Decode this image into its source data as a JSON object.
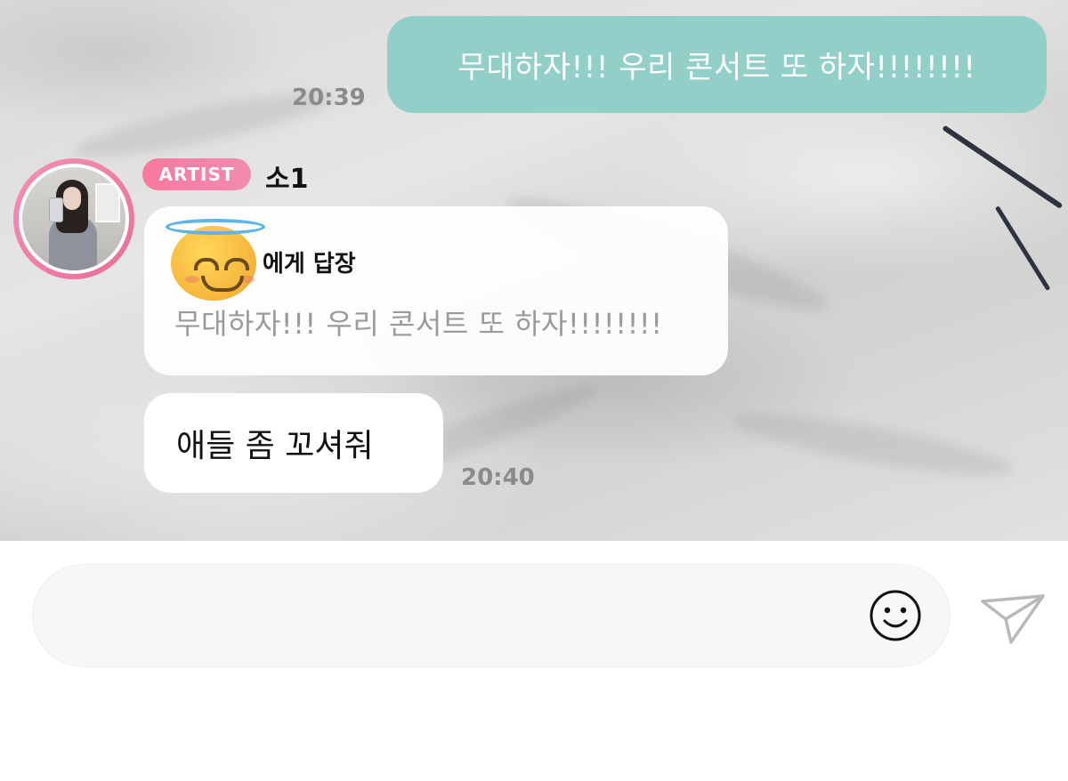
{
  "messages": {
    "sent": {
      "text": "무대하자!!! 우리 콘서트 또 하자!!!!!!!!",
      "time": "20:39"
    },
    "artist": {
      "badge": "ARTIST",
      "name": "소1",
      "reply_to_suffix": "에게 답장",
      "quoted_text": "무대하자!!! 우리 콘서트 또 하자!!!!!!!!",
      "sticker_icon": "smiling-face-with-halo-emoji",
      "message": "애들 좀 꼬셔줘",
      "time": "20:40"
    }
  },
  "composer": {
    "input_value": "",
    "emoji_icon": "smiley-face-icon",
    "send_icon": "paper-plane-icon"
  }
}
